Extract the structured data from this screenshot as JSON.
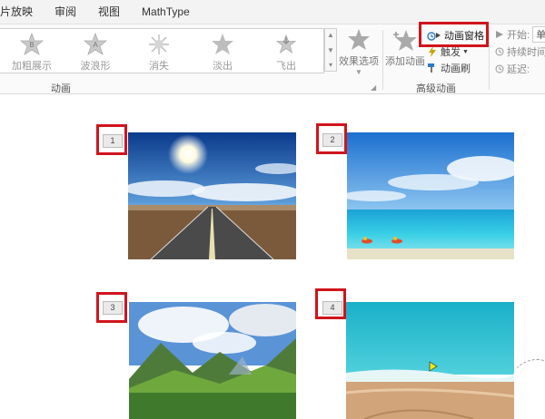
{
  "menu": {
    "tabs": [
      "片放映",
      "审阅",
      "视图",
      "MathType"
    ]
  },
  "ribbon": {
    "gallery": [
      {
        "label": "加粗展示",
        "icon": "emphasis-bold-star-icon",
        "letter": "B"
      },
      {
        "label": "波浪形",
        "icon": "wave-star-icon",
        "letter": "A"
      },
      {
        "label": "消失",
        "icon": "disappear-burst-icon",
        "letter": ""
      },
      {
        "label": "淡出",
        "icon": "fade-out-star-icon",
        "letter": ""
      },
      {
        "label": "飞出",
        "icon": "fly-out-star-icon",
        "letter": ""
      }
    ],
    "effect_options_label": "效果选项",
    "animation_group_label": "动画",
    "add_animation_label": "添加动画",
    "animation_pane_label": "动画窗格",
    "trigger_label": "触发",
    "animation_painter_label": "动画刷",
    "advanced_group_label": "高级动画",
    "timing": {
      "start_label": "开始:",
      "start_value": "单",
      "duration_label": "持续时间",
      "delay_label": "延迟:"
    }
  },
  "slides": [
    {
      "number": "1",
      "scene": "road-sky"
    },
    {
      "number": "2",
      "scene": "beach-sea"
    },
    {
      "number": "3",
      "scene": "mountain-meadow"
    },
    {
      "number": "4",
      "scene": "beach-shore"
    }
  ],
  "colors": {
    "highlight": "#d0141c",
    "accent": "#2b79c2"
  }
}
